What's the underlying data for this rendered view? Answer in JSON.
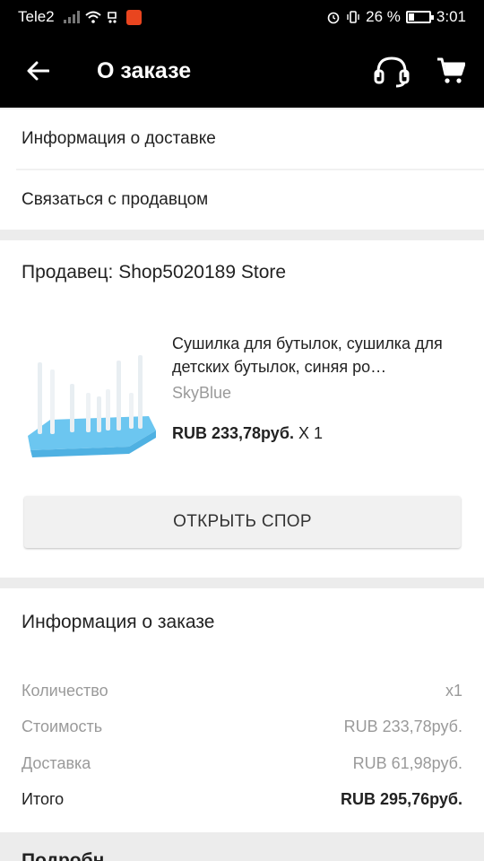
{
  "status_bar": {
    "carrier": "Tele2",
    "battery_percent": "26 %",
    "time": "3:01"
  },
  "app_bar": {
    "title": "О заказе",
    "icons": [
      "back-arrow-icon",
      "headset-icon",
      "cart-icon"
    ]
  },
  "menu": {
    "items": [
      {
        "label": "Информация о доставке"
      },
      {
        "label": "Связаться с продавцом"
      }
    ]
  },
  "seller": {
    "title": "Продавец: Shop5020189 Store",
    "product": {
      "name": "Сушилка для бутылок, сушилка для детских бутылок, синяя ро…",
      "variant": "SkyBlue",
      "price": "RUB 233,78руб.",
      "quantity": " X 1",
      "image_color": "#6cc6f0"
    },
    "dispute_button": "ОТКРЫТЬ СПОР"
  },
  "order_info": {
    "title": "Информация о заказе",
    "rows": [
      {
        "label": "Количество",
        "value": "x1"
      },
      {
        "label": "Стоимость",
        "value": "RUB 233,78руб."
      },
      {
        "label": "Доставка",
        "value": "RUB 61,98руб."
      },
      {
        "label": "Итого",
        "value": "RUB 295,76руб."
      }
    ]
  },
  "next_section": {
    "heading_partial": "Подробн"
  }
}
